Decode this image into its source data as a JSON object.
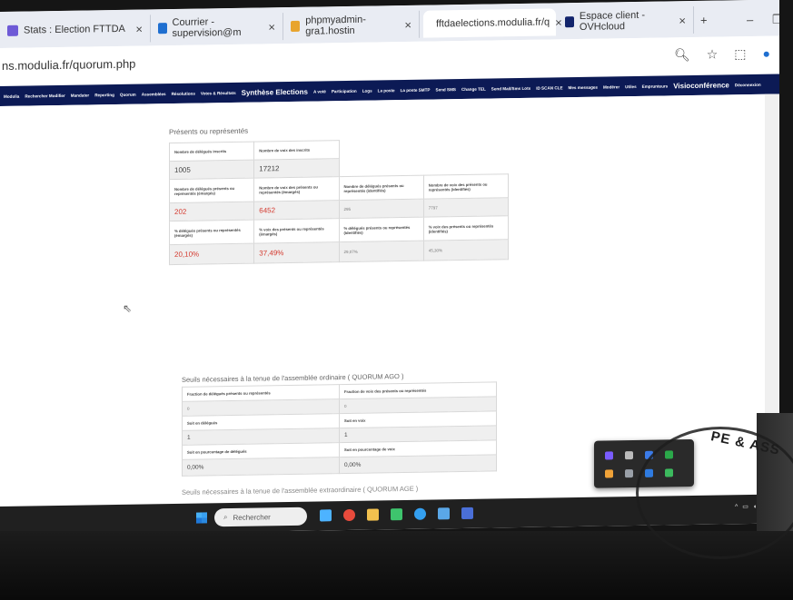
{
  "browser": {
    "tabs": [
      {
        "title": "Stats : Election FTTDA",
        "active": false,
        "icon_color": "#6e5ad6"
      },
      {
        "title": "Courrier - supervision@m",
        "active": false,
        "icon_color": "#1f6fd0"
      },
      {
        "title": "phpmyadmin-gra1.hostin",
        "active": false,
        "icon_color": "#e8a42d"
      },
      {
        "title": "fftdaelections.modulia.fr/q",
        "active": true,
        "icon_color": "#333333"
      },
      {
        "title": "Espace client - OVHcloud",
        "active": false,
        "icon_color": "#12246c"
      }
    ],
    "close_glyph": "×",
    "new_tab_glyph": "+",
    "url": "ns.modulia.fr/quorum.php"
  },
  "nav": {
    "items": [
      "Modulia",
      "Rechercher Modifier",
      "Mandater",
      "Reporting",
      "Quorum",
      "Assemblées",
      "Résolutions",
      "Votes & Résultats",
      "Synthèse Elections",
      "A voté",
      "Participation",
      "Logs",
      "La poste",
      "La poste SMTP",
      "Send SMS",
      "Change TEL",
      "Send Mail/Sms Lots",
      "ID SCAN CLE",
      "Mes messages",
      "Modérer",
      "Utiles",
      "Emprunteurs",
      "Visioconférence",
      "Déconnexion"
    ],
    "big_items": [
      "Synthèse Elections",
      "Visioconférence"
    ]
  },
  "presents": {
    "title": "Présents ou représentés",
    "row1_headers": [
      "Nombre de délégués inscrits",
      "Nombre de voix des inscrits"
    ],
    "row1_values": [
      "1005",
      "17212"
    ],
    "row2_headers": [
      "Nombre de délégués présents ou représentés (émargés)",
      "Nombre de voix des présents ou représentés (émargés)",
      "Nombre de délégués présents ou représentés (identifiés)",
      "Nombre de voix des présents ou représentés (identifiés)"
    ],
    "row2_values": [
      "202",
      "6452",
      "295",
      "7797"
    ],
    "row3_headers": [
      "% délégués présents ou représentés (émargés)",
      "% voix des présents ou représentés (émargés)",
      "% délégués présents ou représentés (identifiés)",
      "% voix des présents ou représentés (identifiés)"
    ],
    "row3_values": [
      "20,10%",
      "37,49%",
      "29,07%",
      "45,30%"
    ]
  },
  "quorum_ago": {
    "title": "Seuils nécessaires à la tenue de l'assemblée ordinaire ( QUORUM AGO )",
    "rows": [
      [
        "Fraction de délégués présents ou représentés",
        "Fraction de voix des présents ou représentés"
      ],
      [
        "0",
        "0"
      ],
      [
        "Soit en délégués",
        "Soit en voix"
      ],
      [
        "1",
        "1"
      ],
      [
        "Soit en pourcentage de délégués",
        "Soit en pourcentage de voix"
      ],
      [
        "0,00%",
        "0,00%"
      ]
    ]
  },
  "quorum_age": {
    "title": "Seuils nécessaires à la tenue de l'assemblée extraordinaire ( QUORUM AGE )"
  },
  "taskbar": {
    "search_placeholder": "Rechercher",
    "search_icon": "magnifier-icon",
    "icons": [
      {
        "name": "network-icon",
        "color": "#4db3ff"
      },
      {
        "name": "chrome-icon",
        "color": "#e84b3c"
      },
      {
        "name": "file-explorer-icon",
        "color": "#f2c14e"
      },
      {
        "name": "green-app-icon",
        "color": "#3ec46d"
      },
      {
        "name": "colorful-app-icon",
        "color": "#34a0f0"
      },
      {
        "name": "store-icon",
        "color": "#5aa7e8"
      },
      {
        "name": "calculator-icon",
        "color": "#4a6fd8"
      }
    ]
  },
  "stamp_text": "PE & ASS"
}
